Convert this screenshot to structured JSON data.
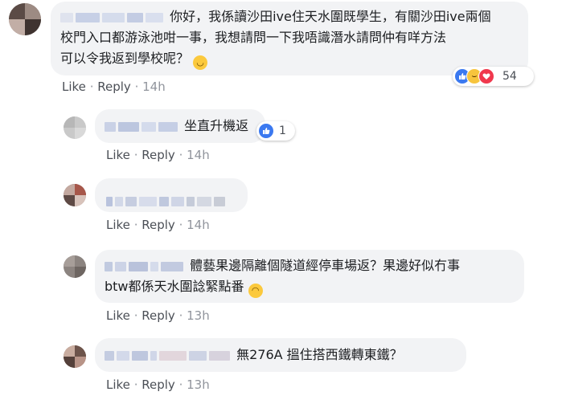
{
  "comments": [
    {
      "text_line1": "你好，我係讀沙田ive住天水圍既學生，有關沙田ive兩個",
      "text_line2": "校門入口都游泳池咁一事，我想請問一下我唔識潛水請問仲有咩方法",
      "text_line3": "可以令我返到學校呢？",
      "emoji": "relieved",
      "reactions": {
        "types": [
          "like",
          "haha",
          "love"
        ],
        "count": "54"
      },
      "actions": {
        "like": "Like",
        "reply": "Reply",
        "time": "14h"
      }
    },
    {
      "text": "坐直升機返",
      "reactions": {
        "types": [
          "like"
        ],
        "count": "1"
      },
      "actions": {
        "like": "Like",
        "reply": "Reply",
        "time": "14h"
      }
    },
    {
      "actions": {
        "like": "Like",
        "reply": "Reply",
        "time": "14h"
      }
    },
    {
      "text_line1": "體藝果邊隔離個隧道經停車場返？果邊好似冇事",
      "text_line2": "btw都係天水圍諗緊點番",
      "emoji": "laughing",
      "actions": {
        "like": "Like",
        "reply": "Reply",
        "time": "13h"
      }
    },
    {
      "text": "無276A 搵住搭西鐵轉東鐵？",
      "actions": {
        "like": "Like",
        "reply": "Reply",
        "time": "13h"
      }
    }
  ],
  "separator_dot": "·",
  "colors": {
    "bubble_bg": "#f2f3f5",
    "action_link": "#4b4f56",
    "meta": "#90949c",
    "like_blue": "#3b79f0",
    "haha_yellow": "#f7c43d",
    "love_red": "#f0384d"
  }
}
